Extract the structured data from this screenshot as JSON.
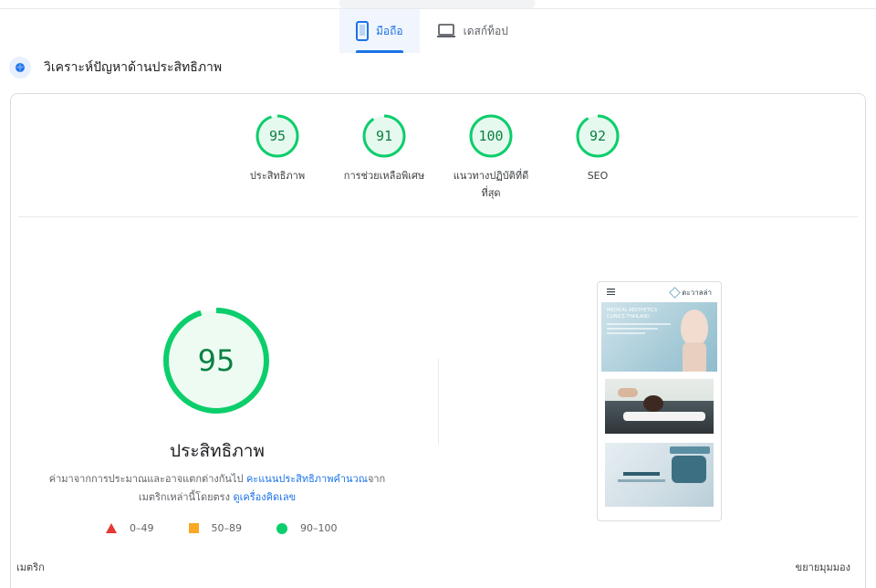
{
  "device_tabs": {
    "mobile_label": "มือถือ",
    "desktop_label": "เดสก์ท็อป"
  },
  "section": {
    "title": "วิเคราะห์ปัญหาด้านประสิทธิภาพ"
  },
  "scores": [
    {
      "value": "95",
      "score": 95,
      "label": "ประสิทธิภาพ"
    },
    {
      "value": "91",
      "score": 91,
      "label": "การช่วยเหลือพิเศษ"
    },
    {
      "value": "100",
      "score": 100,
      "label_line1": "แนวทางปฏิบัติที่ดี",
      "label_line2": "ที่สุด"
    },
    {
      "value": "92",
      "score": 92,
      "label": "SEO"
    }
  ],
  "main": {
    "score": "95",
    "score_value": 95,
    "title": "ประสิทธิภาพ",
    "desc_part1": "ค่ามาจากการประมาณและอาจแตกต่างกันไป ",
    "desc_link1": "คะแนนประสิทธิภาพคำนวณ",
    "desc_part2": "จาก",
    "desc_part3": "เมตริกเหล่านี้โดยตรง ",
    "desc_link2": "ดูเครื่องคิดเลข"
  },
  "legend": {
    "low": "0–49",
    "mid": "50–89",
    "high": "90–100"
  },
  "screenshot": {
    "logo_text": "ดะวาลล่า",
    "hero_text_1": "MEDICAL AESTHETICS",
    "hero_text_2": "CLINICS THAILAND"
  },
  "footer": {
    "metrics_label": "เมตริก",
    "expand_label": "ขยายมุมมอง"
  },
  "colors": {
    "pass": "#0cce6b",
    "pass_text": "#0b8043",
    "fail": "#e53935",
    "average": "#f9a825",
    "accent": "#1a73e8"
  }
}
